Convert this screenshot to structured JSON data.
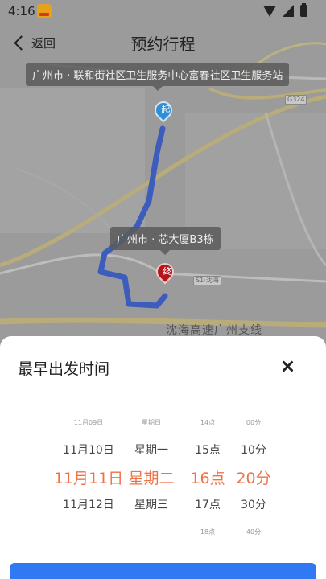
{
  "status_bar": {
    "time": "4:16",
    "app_icon": "news-app-icon",
    "icons": [
      "wifi-icon",
      "signal-icon",
      "battery-icon"
    ]
  },
  "header": {
    "back_label": "返回",
    "title": "预约行程"
  },
  "map": {
    "start_label": "广州市 · 联和街社区卫生服务中心富春社区卫生服务站",
    "end_label": "广州市 · 芯大厦B3栋",
    "start_marker": "起",
    "end_marker": "终",
    "road_name": "沈海高速广州支线",
    "route_color": "#3d5dbd",
    "road_badges": [
      "G324",
      "S1·沈海"
    ]
  },
  "sheet": {
    "title": "最早出发时间",
    "close_icon": "close-icon",
    "picker": {
      "rows": [
        {
          "date": "11月09日",
          "weekday": "星期日",
          "hour": "14点",
          "minute": "00分"
        },
        {
          "date": "11月10日",
          "weekday": "星期一",
          "hour": "15点",
          "minute": "10分"
        },
        {
          "date": "11月11日",
          "weekday": "星期二",
          "hour": "16点",
          "minute": "20分"
        },
        {
          "date": "11月12日",
          "weekday": "星期三",
          "hour": "17点",
          "minute": "30分"
        },
        {
          "date": "",
          "weekday": "",
          "hour": "18点",
          "minute": "40分"
        }
      ],
      "selected_index": 2,
      "accent_color": "#ef7246"
    },
    "confirm_color": "#2f79f2"
  }
}
